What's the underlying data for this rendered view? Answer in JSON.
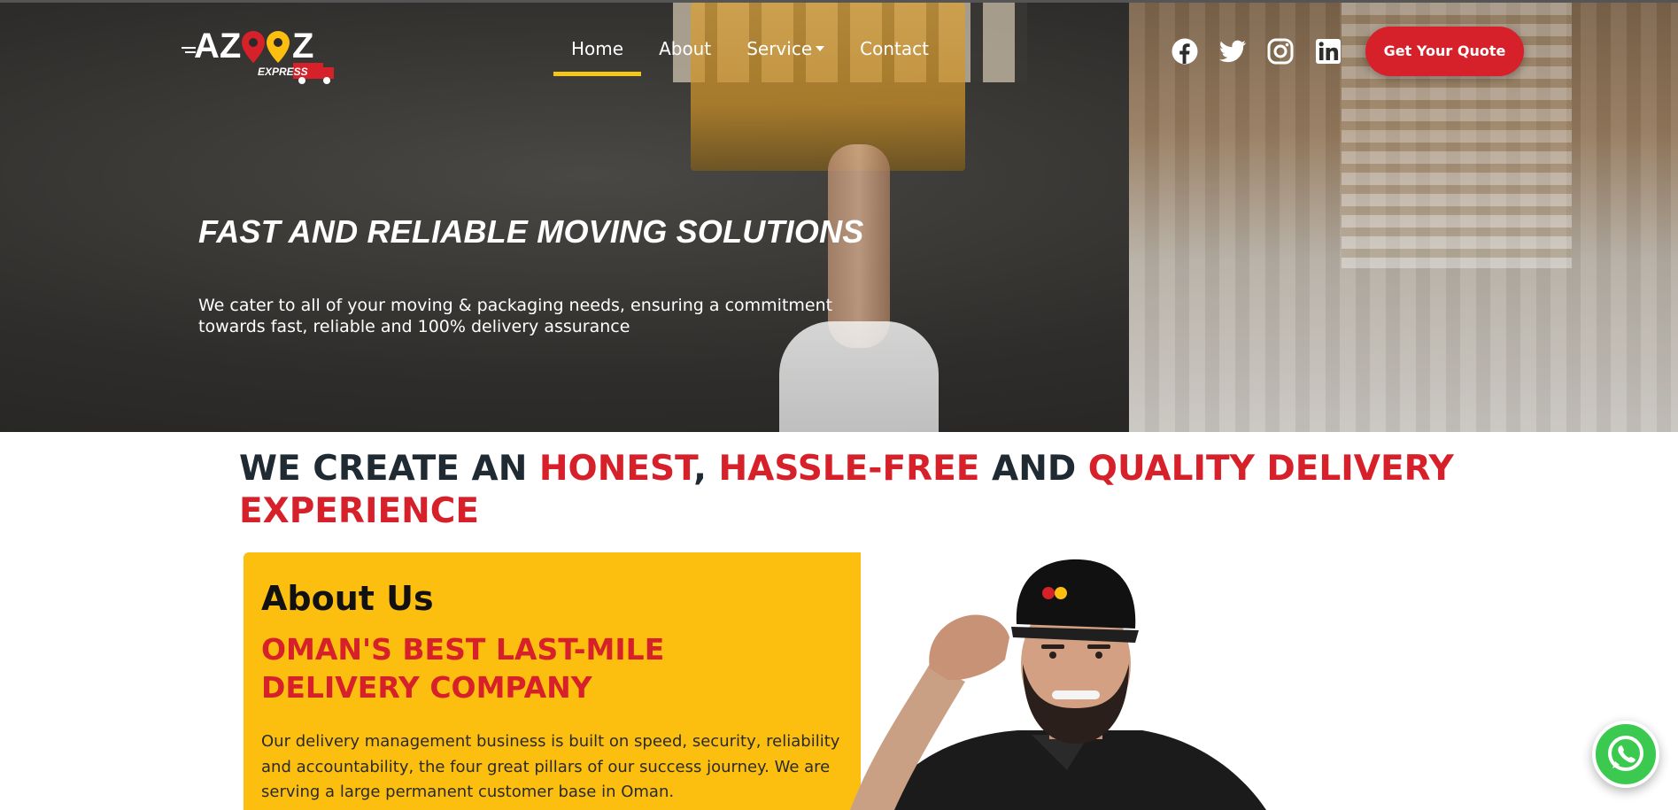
{
  "brand": {
    "logo_text": "AZOOZ",
    "logo_tagline": "EXPRESS",
    "colors": {
      "red": "#d6202a",
      "yellow": "#fdbf0f",
      "nav_underline": "#f5c518",
      "dark": "#1f2a33",
      "whatsapp": "#3cc94f"
    }
  },
  "nav": {
    "items": [
      {
        "label": "Home",
        "active": true
      },
      {
        "label": "About"
      },
      {
        "label": "Service",
        "dropdown": true
      },
      {
        "label": "Contact"
      }
    ]
  },
  "social": [
    {
      "icon": "facebook-icon"
    },
    {
      "icon": "twitter-icon"
    },
    {
      "icon": "instagram-icon"
    },
    {
      "icon": "linkedin-icon"
    }
  ],
  "cta": {
    "label": "Get Your Quote"
  },
  "hero": {
    "title": "FAST AND RELIABLE MOVING SOLUTIONS",
    "subtitle": "We cater to all of your moving & packaging needs, ensuring a commitment towards fast, reliable and 100% delivery assurance"
  },
  "headline": {
    "part1": "WE CREATE AN ",
    "part2": "HONEST",
    "part3": ", ",
    "part4": "HASSLE-FREE",
    "part5": " AND ",
    "part6": "QUALITY DELIVERY EXPERIENCE"
  },
  "about": {
    "title": "About Us",
    "subtitle": "OMAN'S BEST LAST-MILE DELIVERY COMPANY",
    "text": "Our delivery management business is built on speed, security, reliability and accountability, the four great pillars of our success journey. We are serving a large permanent customer base in Oman."
  },
  "floating": {
    "icon": "whatsapp-icon"
  }
}
